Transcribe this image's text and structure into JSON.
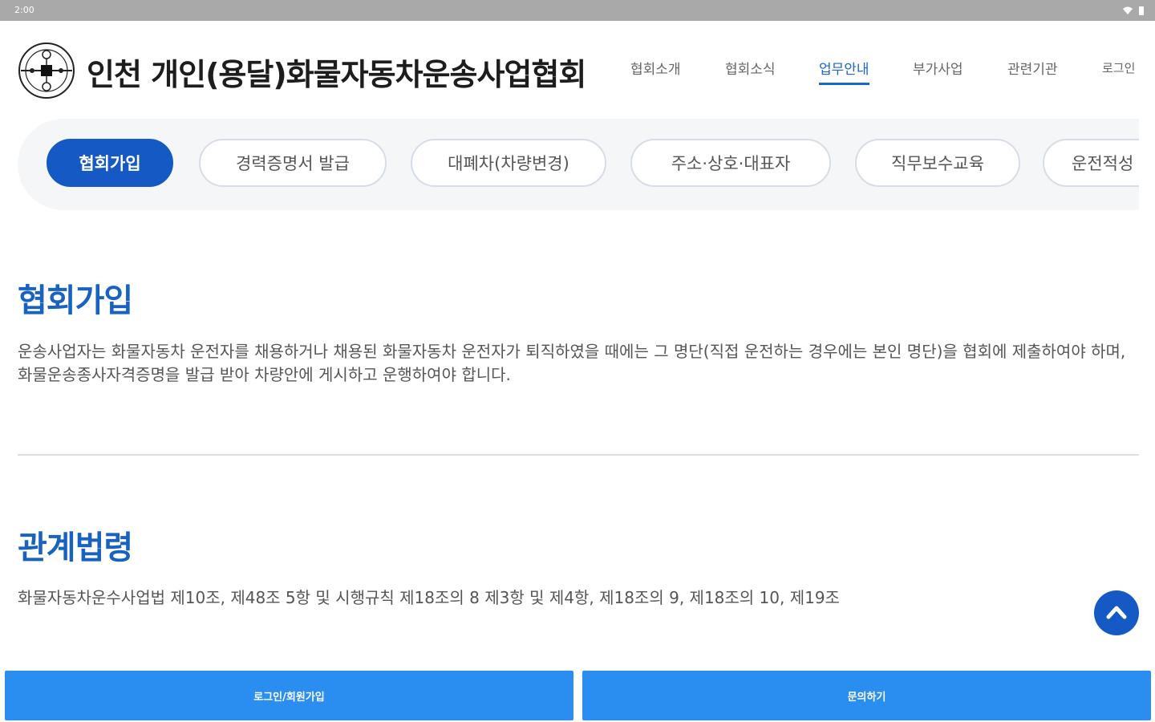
{
  "status_bar": {
    "time": "2:00",
    "wifi_icon": "wifi-icon",
    "battery_icon": "battery-icon"
  },
  "header": {
    "logo_icon": "association-emblem-icon",
    "title": "인천 개인(용달)화물자동차운송사업협회",
    "nav": [
      {
        "label": "협회소개"
      },
      {
        "label": "협회소식"
      },
      {
        "label": "업무안내",
        "active": true
      },
      {
        "label": "부가사업"
      },
      {
        "label": "관련기관"
      },
      {
        "label": "로그인"
      }
    ]
  },
  "tabs": [
    {
      "label": "협회가입",
      "active": true
    },
    {
      "label": "경력증명서 발급"
    },
    {
      "label": "대폐차(차량변경)"
    },
    {
      "label": "주소·상호·대표자"
    },
    {
      "label": "직무보수교육"
    },
    {
      "label": "운전적성"
    }
  ],
  "sections": {
    "join": {
      "title": "협회가입",
      "text": "운송사업자는 화물자동차 운전자를 채용하거나 채용된 화물자동차 운전자가 퇴직하였을 때에는 그 명단(직접 운전하는 경우에는 본인 명단)을 협회에 제출하여야 하며, 화물운송종사자격증명을 발급 받아 차량안에 게시하고 운행하여야 합니다."
    },
    "law": {
      "title": "관계법령",
      "text": "화물자동차운수사업법 제10조, 제48조 5항 및 시행규칙 제18조의 8 제3항 및 제4항, 제18조의 9, 제18조의 10, 제19조"
    }
  },
  "scroll_top_icon": "chevron-up-icon",
  "bottom_buttons": {
    "login": "로그인/회원가입",
    "inquiry": "문의하기"
  },
  "colors": {
    "primary": "#1459c4",
    "title_blue": "#1a62c0",
    "bottom_button": "#2a8ef0",
    "status_bar": "#a9a9a9"
  }
}
